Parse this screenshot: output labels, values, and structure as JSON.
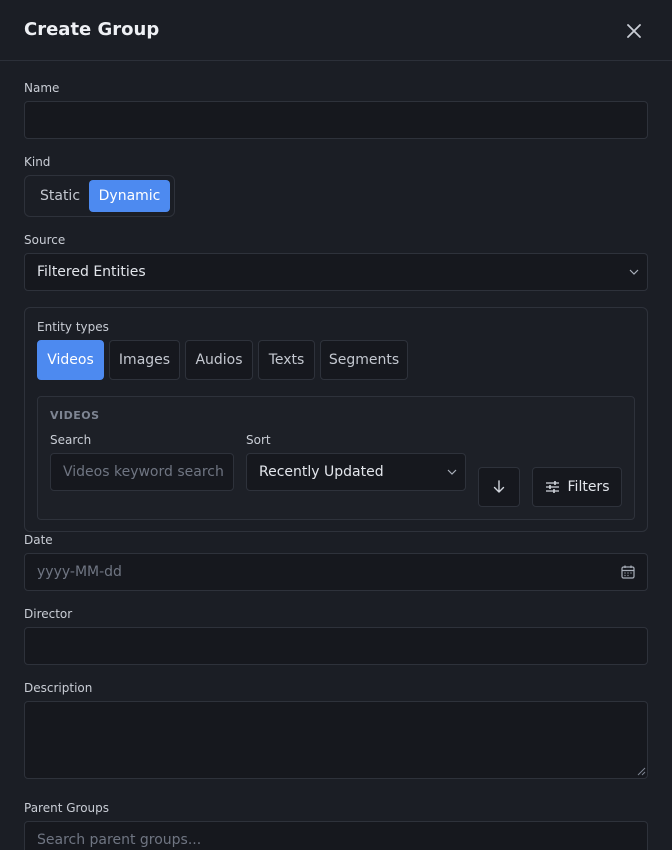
{
  "dialog": {
    "title": "Create Group"
  },
  "fields": {
    "name": {
      "label": "Name",
      "value": ""
    },
    "kind": {
      "label": "Kind",
      "options": [
        "Static",
        "Dynamic"
      ],
      "selected": "Dynamic"
    },
    "source": {
      "label": "Source",
      "value": "Filtered Entities"
    },
    "entity_types": {
      "label": "Entity types",
      "tabs": [
        "Videos",
        "Images",
        "Audios",
        "Texts",
        "Segments"
      ],
      "active": "Videos"
    },
    "videos": {
      "section_title": "VIDEOS",
      "search_label": "Search",
      "search_placeholder": "Videos keyword search",
      "sort_label": "Sort",
      "sort_value": "Recently Updated",
      "filters_label": "Filters"
    },
    "date": {
      "label": "Date",
      "placeholder": "yyyy-MM-dd"
    },
    "director": {
      "label": "Director",
      "value": ""
    },
    "description": {
      "label": "Description",
      "value": ""
    },
    "parent_groups": {
      "label": "Parent Groups",
      "placeholder": "Search parent groups..."
    }
  },
  "colors": {
    "accent": "#4d8af0",
    "background": "#1b1e25",
    "input": "#16181e",
    "border": "#2e323b"
  },
  "icons": [
    "close-icon",
    "chevron-down-icon",
    "arrow-down-icon",
    "sliders-icon",
    "calendar-icon"
  ]
}
